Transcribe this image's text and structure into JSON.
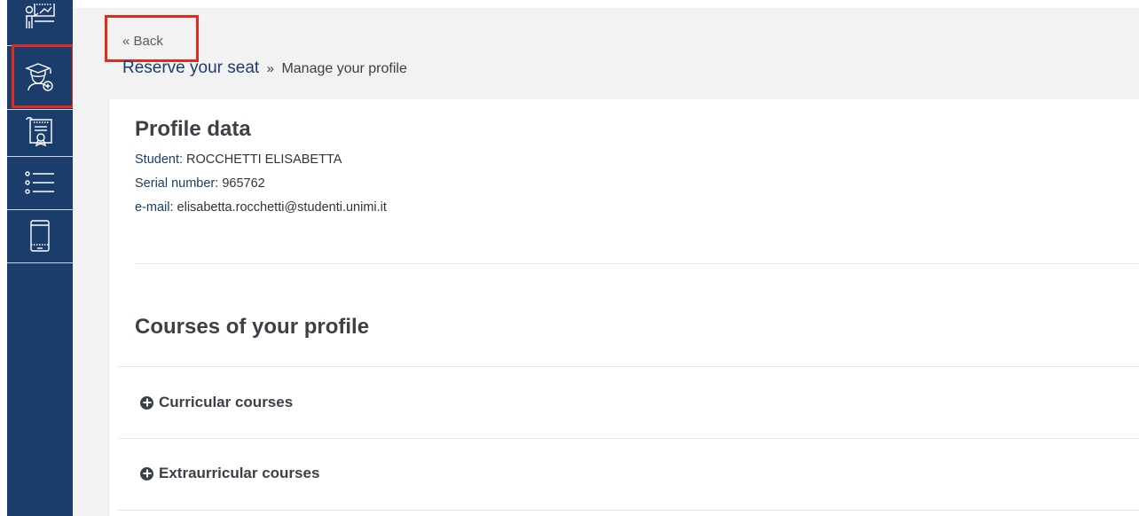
{
  "sidebar": {
    "items": [
      {
        "icon": "teacher-board-icon"
      },
      {
        "icon": "graduate-add-icon"
      },
      {
        "icon": "certificate-scroll-icon"
      },
      {
        "icon": "list-icon"
      },
      {
        "icon": "tablet-icon"
      }
    ]
  },
  "header": {
    "back_label": "« Back",
    "breadcrumb_link": "Reserve your seat",
    "breadcrumb_sep": "»",
    "breadcrumb_current": "Manage your profile"
  },
  "profile": {
    "title": "Profile data",
    "student_label": "Student:",
    "student_value": "ROCCHETTI ELISABETTA",
    "serial_label": "Serial number:",
    "serial_value": "965762",
    "email_label": "e-mail:",
    "email_value": "elisabetta.rocchetti@studenti.unimi.it"
  },
  "courses": {
    "title": "Courses of your profile",
    "curricular_label": "Curricular courses",
    "extracurricular_label": "Extraurricular courses"
  },
  "colors": {
    "sidebar_bg": "#1b3d6b",
    "highlight": "#e12b1e",
    "link": "#1b3d6b"
  }
}
